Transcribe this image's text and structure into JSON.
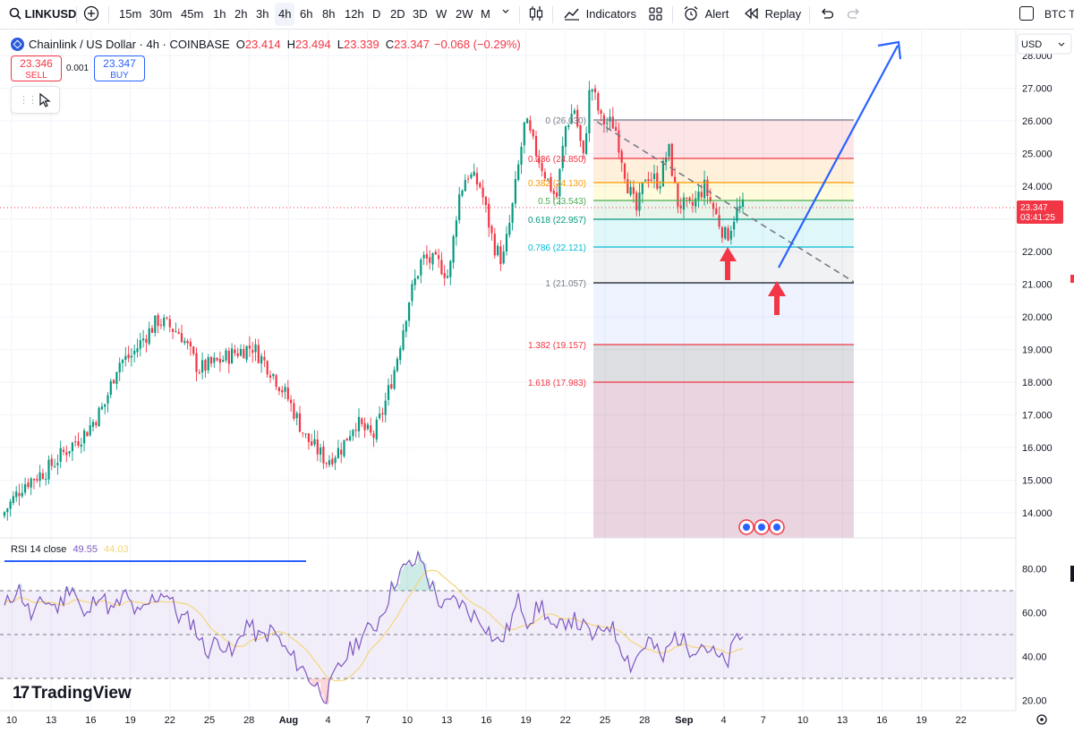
{
  "toolbar": {
    "symbol": "LINKUSD",
    "intervals": [
      "15m",
      "30m",
      "45m",
      "1h",
      "2h",
      "3h",
      "4h",
      "6h",
      "8h",
      "12h",
      "D",
      "2D",
      "3D",
      "W",
      "2W",
      "M"
    ],
    "active_interval": "4h",
    "indicators_label": "Indicators",
    "alert_label": "Alert",
    "replay_label": "Replay",
    "compare_symbol": "BTC T"
  },
  "legend": {
    "title": "Chainlink / US Dollar · 4h · COINBASE",
    "open_key": "O",
    "open": "23.414",
    "high_key": "H",
    "high": "23.494",
    "low_key": "L",
    "low": "23.339",
    "close_key": "C",
    "close": "23.347",
    "change": "−0.068 (−0.29%)"
  },
  "trade": {
    "sell_price": "23.346",
    "sell_label": "SELL",
    "spread": "0.001",
    "buy_price": "23.347",
    "buy_label": "BUY"
  },
  "price_axis": {
    "currency": "USD",
    "ticks": [
      "28.000",
      "27.000",
      "26.000",
      "25.000",
      "24.000",
      "23.000",
      "22.000",
      "21.000",
      "20.000",
      "19.000",
      "18.000",
      "17.000",
      "16.000",
      "15.000",
      "14.000"
    ],
    "last_price": "23.347",
    "countdown": "03:41:25"
  },
  "rsi": {
    "label": "RSI 14 close",
    "value": "49.55",
    "ma_value": "44.03",
    "ticks": [
      "80.00",
      "60.00",
      "40.00",
      "20.00"
    ]
  },
  "time_axis": {
    "labels": [
      "10",
      "13",
      "16",
      "19",
      "22",
      "25",
      "28",
      "Aug",
      "4",
      "7",
      "10",
      "13",
      "16",
      "19",
      "22",
      "25",
      "28",
      "Sep",
      "4",
      "7",
      "10",
      "13",
      "16",
      "19",
      "22"
    ]
  },
  "fibonacci": [
    {
      "label": "0 (26.030)",
      "color": "#787b86"
    },
    {
      "label": "0.236 (24.850)",
      "color": "#f23645"
    },
    {
      "label": "0.382 (24.130)",
      "color": "#ff9800"
    },
    {
      "label": "0.5 (23.543)",
      "color": "#4caf50"
    },
    {
      "label": "0.618 (22.957)",
      "color": "#089981"
    },
    {
      "label": "0.786 (22.121)",
      "color": "#00bcd4"
    },
    {
      "label": "1 (21.057)",
      "color": "#787b86"
    },
    {
      "label": "1.382 (19.157)",
      "color": "#f23645"
    },
    {
      "label": "1.618 (17.983)",
      "color": "#f23645"
    }
  ],
  "brand": "TradingView",
  "colors": {
    "up": "#089981",
    "down": "#f23645",
    "rsi_line": "#7e57c2",
    "rsi_ma": "#f4d57a",
    "projection_arrow": "#2962ff",
    "marker_arrow": "#f23645"
  }
}
